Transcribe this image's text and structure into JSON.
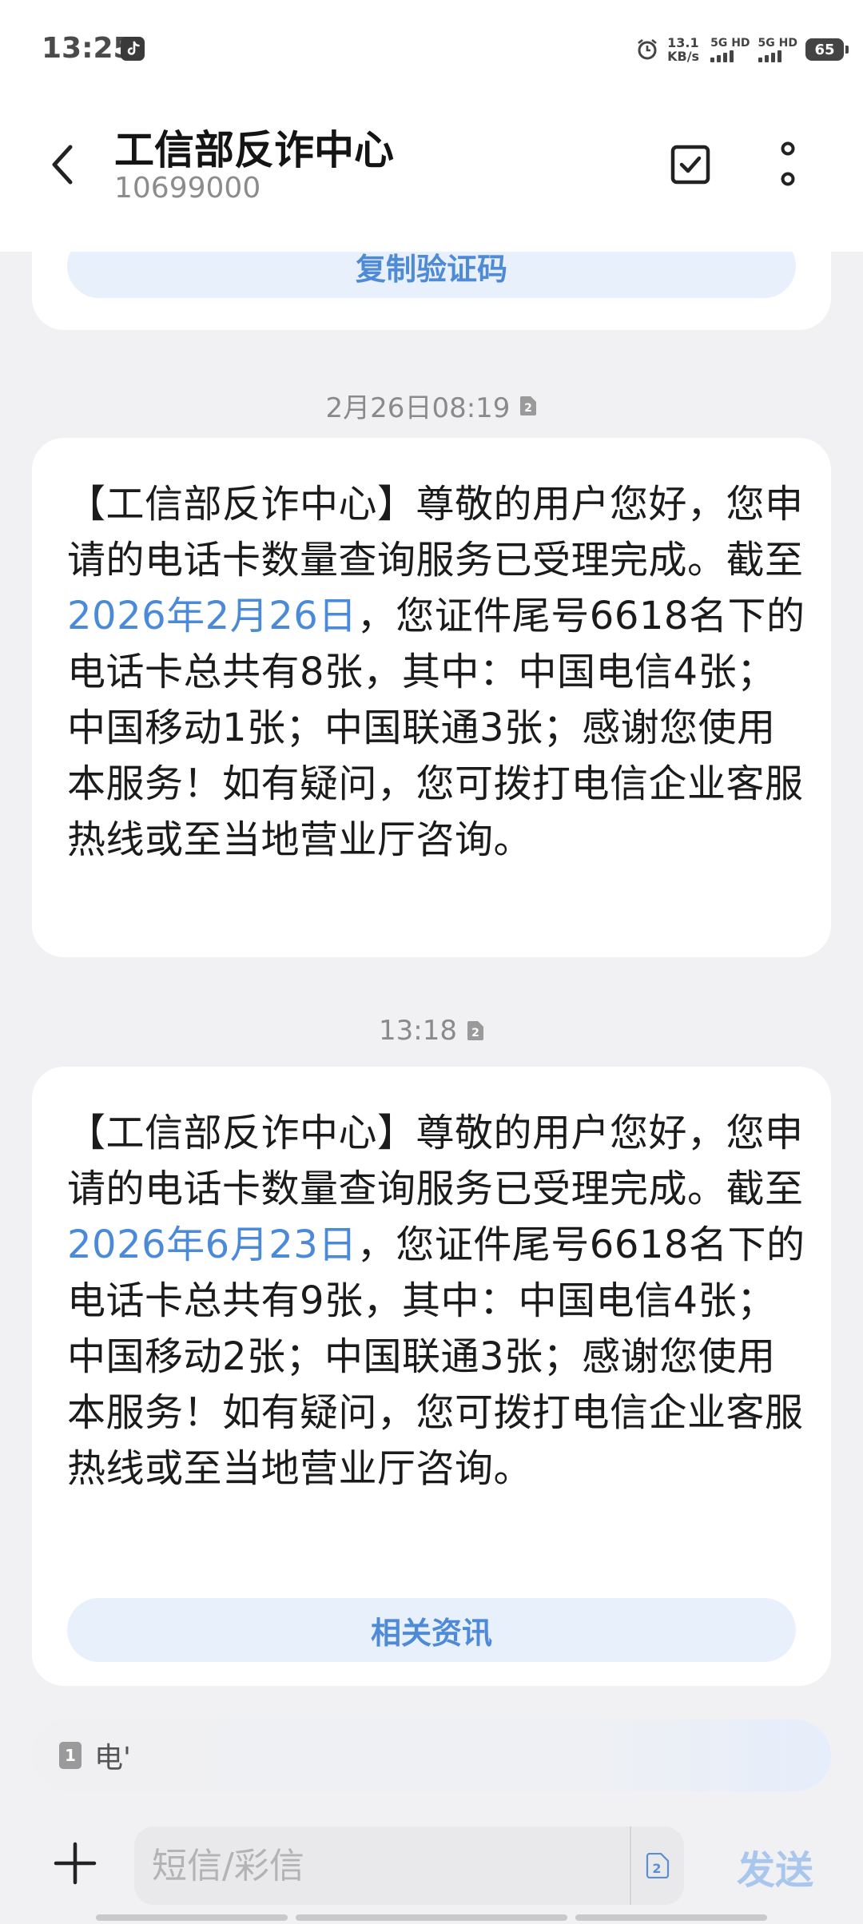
{
  "status_bar": {
    "time": "13:25",
    "speed_value": "13.1",
    "speed_unit": "KB/s",
    "sim1_label": "5G HD",
    "sim2_label": "5G HD",
    "battery": "65",
    "icons": [
      "tiktok-icon",
      "alarm-icon",
      "signal-icon",
      "battery-icon"
    ]
  },
  "header": {
    "name": "工信部反诈中心",
    "number": "10699000",
    "icons": [
      "back-icon",
      "select-icon",
      "more-icon"
    ]
  },
  "messages": [
    {
      "button": "复制验证码"
    },
    {
      "timestamp": "2月26日08:19",
      "sim_slot": "2",
      "text_pre": "【工信部反诈中心】尊敬的用户您好，您申请的电话卡数量查询服务已受理完成。截至",
      "date": "2026年2月26日",
      "text_post": "，您证件尾号6618名下的电话卡总共有8张，其中：中国电信4张；中国移动1张；中国联通3张；感谢您使用本服务！如有疑问，您可拨打电信企业客服热线或至当地营业厅咨询。"
    },
    {
      "timestamp": "13:18",
      "sim_slot": "2",
      "text_pre": "【工信部反诈中心】尊敬的用户您好，您申请的电话卡数量查询服务已受理完成。截至",
      "date": "2026年6月23日",
      "text_post": "，您证件尾号6618名下的电话卡总共有9张，其中：中国电信4张；中国移动2张；中国联通3张；感谢您使用本服务！如有疑问，您可拨打电信企业客服热线或至当地营业厅咨询。",
      "button": "相关资讯"
    }
  ],
  "suggestion": {
    "sim_slot": "1",
    "text": "电'"
  },
  "compose": {
    "placeholder": "短信/彩信",
    "sim_slot": "2",
    "send_label": "发送"
  },
  "colors": {
    "accent": "#4b8ad9",
    "send_disabled": "#a9c6ee",
    "background": "#f1f1f3",
    "bubble": "#ffffff"
  }
}
